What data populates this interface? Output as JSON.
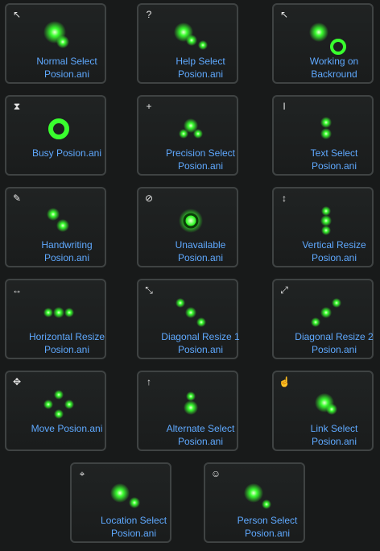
{
  "cursors": [
    {
      "line1": "Normal Select",
      "line2": "Posion.ani",
      "icon": "arrow-icon"
    },
    {
      "line1": "Help Select",
      "line2": "Posion.ani",
      "icon": "help-icon"
    },
    {
      "line1": "Working on",
      "line2": "Backround",
      "icon": "working-icon"
    },
    {
      "line1": "Busy Posion.ani",
      "line2": "",
      "icon": "hourglass-icon"
    },
    {
      "line1": "Precision Select",
      "line2": "Posion.ani",
      "icon": "crosshair-icon"
    },
    {
      "line1": "Text Select",
      "line2": "Posion.ani",
      "icon": "text-beam-icon"
    },
    {
      "line1": "Handwriting",
      "line2": "Posion.ani",
      "icon": "pen-icon"
    },
    {
      "line1": "Unavailable",
      "line2": "Posion.ani",
      "icon": "unavailable-icon"
    },
    {
      "line1": "Vertical Resize",
      "line2": "Posion.ani",
      "icon": "vertical-resize-icon"
    },
    {
      "line1": "Horizontal Resize",
      "line2": "Posion.ani",
      "icon": "horizontal-resize-icon"
    },
    {
      "line1": "Diagonal Resize 1",
      "line2": "Posion.ani",
      "icon": "diagonal-resize-1-icon"
    },
    {
      "line1": "Diagonal Resize 2",
      "line2": "Posion.ani",
      "icon": "diagonal-resize-2-icon"
    },
    {
      "line1": "Move Posion.ani",
      "line2": "",
      "icon": "move-icon"
    },
    {
      "line1": "Alternate Select",
      "line2": "Posion.ani",
      "icon": "up-arrow-icon"
    },
    {
      "line1": "Link Select",
      "line2": "Posion.ani",
      "icon": "hand-icon"
    },
    {
      "line1": "Location Select",
      "line2": "Posion.ani",
      "icon": "location-pin-icon"
    },
    {
      "line1": "Person Select",
      "line2": "Posion.ani",
      "icon": "person-icon"
    }
  ],
  "colors": {
    "accent": "#5fa9ff",
    "glow": "#39ff2e",
    "border": "#3f4343",
    "background": "#181a1a"
  }
}
